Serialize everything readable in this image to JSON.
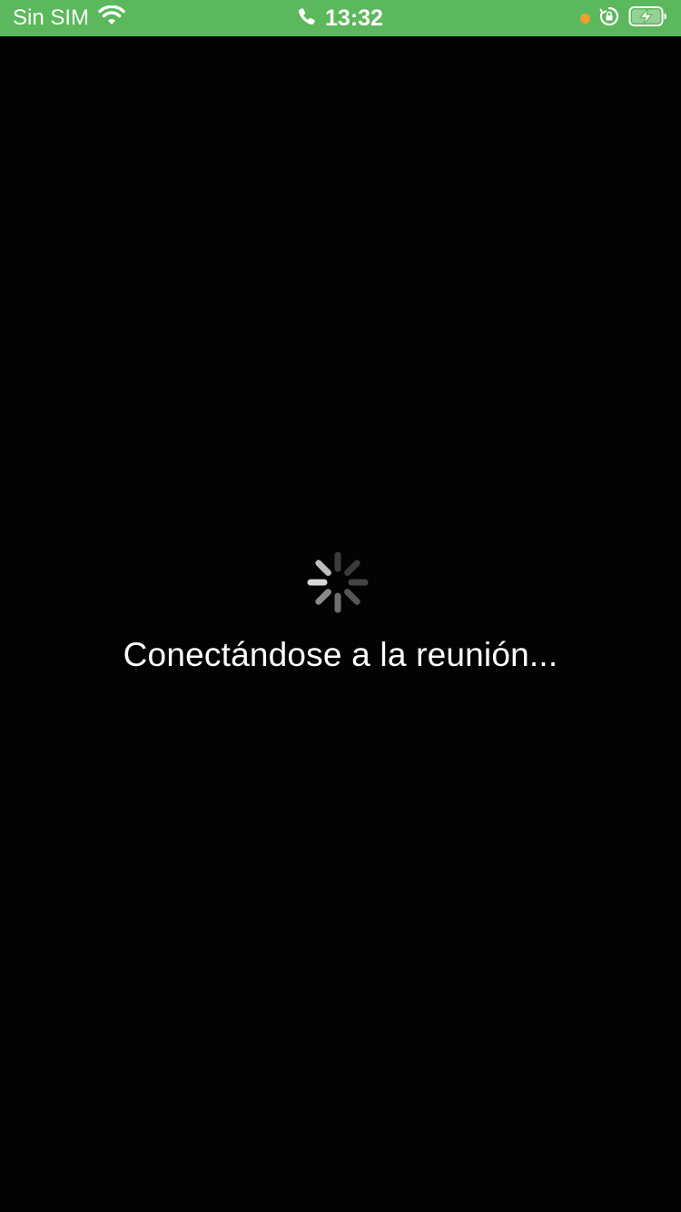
{
  "status_bar": {
    "carrier": "Sin SIM",
    "time": "13:32",
    "background_color": "#5cb85c",
    "recording_dot_color": "#f0a030",
    "icons": [
      "wifi-icon",
      "phone-call-icon",
      "recording-indicator-icon",
      "orientation-lock-icon",
      "battery-charging-icon"
    ]
  },
  "main": {
    "background_color": "#030303",
    "loading_message": "Conectándose a la reunión...",
    "spinner_icon": "activity-spinner-icon"
  }
}
